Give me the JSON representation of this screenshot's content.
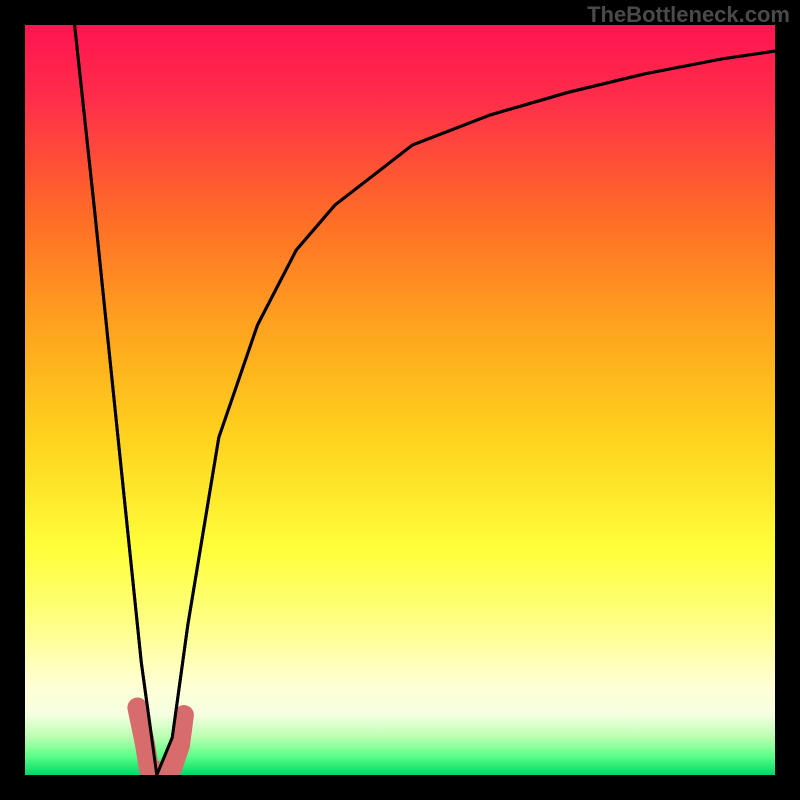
{
  "watermark": "TheBottleneck.com",
  "chart_data": {
    "type": "line",
    "title": "",
    "xlabel": "",
    "ylabel": "",
    "xlim": [
      0,
      100
    ],
    "ylim": [
      0,
      100
    ],
    "grid": false,
    "legend": false,
    "series": [
      {
        "name": "bottleneck-curve",
        "x": [
          6.4,
          9,
          12,
          15,
          17,
          19,
          21,
          25,
          30,
          35,
          40,
          50,
          60,
          70,
          80,
          90,
          100
        ],
        "y": [
          100,
          75,
          45,
          15,
          0,
          5,
          20,
          45,
          60,
          70,
          76,
          84,
          88,
          91,
          93.5,
          95.5,
          97
        ]
      }
    ],
    "markers": {
      "name": "selected-points",
      "color": "#d86b6b",
      "points": [
        {
          "x": 14.5,
          "y": 9,
          "r": 5
        },
        {
          "x": 15.5,
          "y": 4,
          "r": 6
        },
        {
          "x": 16.0,
          "y": 0.8,
          "r": 8
        },
        {
          "x": 17.0,
          "y": 0.5,
          "r": 8
        },
        {
          "x": 18.0,
          "y": 0.5,
          "r": 8
        },
        {
          "x": 19.0,
          "y": 1.0,
          "r": 8
        },
        {
          "x": 20.0,
          "y": 4,
          "r": 8
        },
        {
          "x": 20.5,
          "y": 8,
          "r": 8
        }
      ]
    },
    "background_bands": [
      {
        "y0": 100,
        "y1": 28,
        "from": "#ff0040",
        "to": "#ff8a1e"
      },
      {
        "y0": 28,
        "y1": 16,
        "from": "#ffd21e",
        "to": "#ffff40"
      },
      {
        "y0": 16,
        "y1": 10,
        "from": "#ffff66",
        "to": "#ffffaa"
      },
      {
        "y0": 10,
        "y1": 7,
        "from": "#ffffc8",
        "to": "#ffffe6"
      },
      {
        "y0": 7,
        "y1": 3,
        "from": "#e8ffcc",
        "to": "#8aff8a"
      },
      {
        "y0": 3,
        "y1": 0,
        "from": "#22e86f",
        "to": "#00d860"
      }
    ]
  }
}
